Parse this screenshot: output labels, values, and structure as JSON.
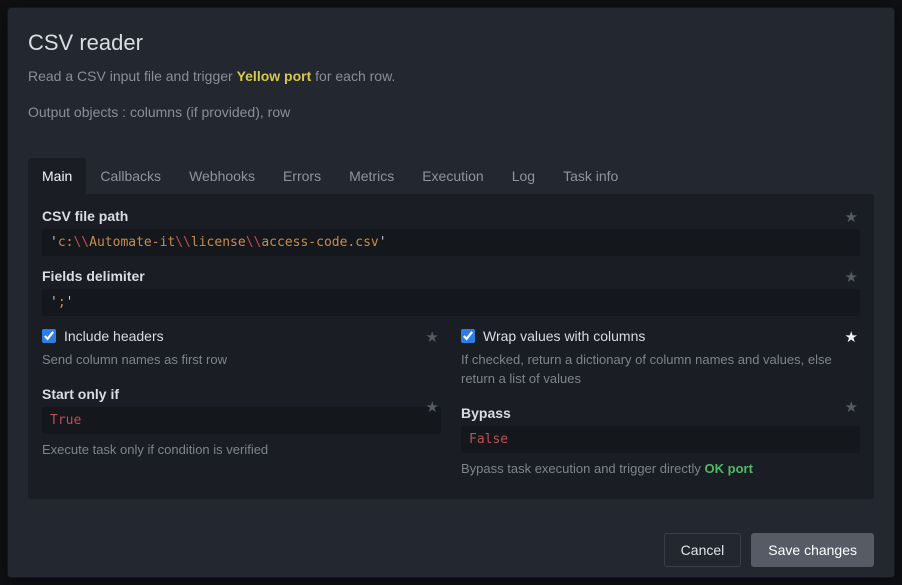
{
  "header": {
    "title": "CSV reader",
    "subtitle_pre": "Read a CSV input file and trigger ",
    "subtitle_highlight": "Yellow port",
    "subtitle_post": "  for each row.",
    "outputs": "Output objects : columns (if provided), row"
  },
  "tabs": {
    "main": "Main",
    "callbacks": "Callbacks",
    "webhooks": "Webhooks",
    "errors": "Errors",
    "metrics": "Metrics",
    "execution": "Execution",
    "log": "Log",
    "taskinfo": "Task info"
  },
  "fields": {
    "csv_path": {
      "label": "CSV file path",
      "value_parts": {
        "q1": "'",
        "s1": "c:",
        "e1": "\\\\",
        "s2": "Automate-it",
        "e2": "\\\\",
        "s3": "license",
        "e3": "\\\\",
        "s4": "access-code.csv",
        "q2": "'"
      }
    },
    "delimiter": {
      "label": "Fields delimiter",
      "value_parts": {
        "q1": "'",
        "s1": ";",
        "q2": "'"
      }
    },
    "include_headers": {
      "label": "Include headers",
      "help": "Send column names as first row"
    },
    "wrap_values": {
      "label": "Wrap values with columns",
      "help": "If checked, return a dictionary of column names and values, else return a list of values"
    },
    "start_only_if": {
      "label": "Start only if",
      "value": "True",
      "help": "Execute task only if condition is verified"
    },
    "bypass": {
      "label": "Bypass",
      "value": "False",
      "help_pre": "Bypass task execution and trigger directly ",
      "help_ok": "OK port"
    }
  },
  "footer": {
    "cancel": "Cancel",
    "save": "Save changes"
  }
}
